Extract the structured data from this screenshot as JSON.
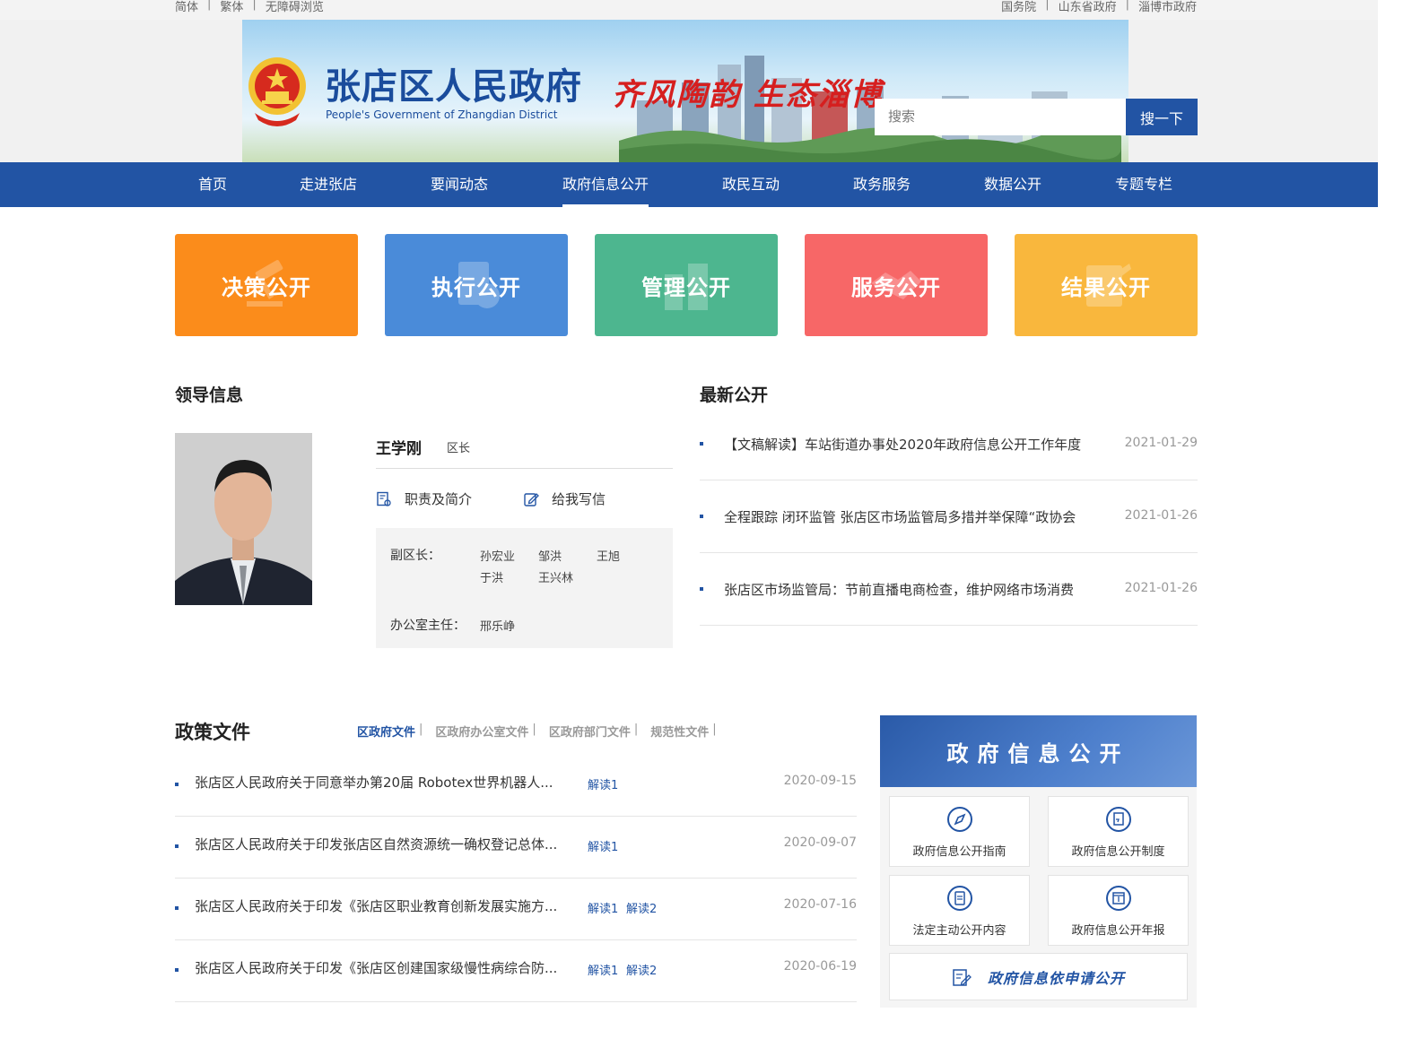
{
  "topbar": {
    "left_links": [
      "简体",
      "繁体",
      "无障碍浏览"
    ],
    "right_links": [
      "国务院",
      "山东省政府",
      "淄博市政府"
    ]
  },
  "header": {
    "title": "张店区人民政府",
    "subtitle": "People's Government of Zhangdian District",
    "slogan": "齐风陶韵  生态淄博",
    "search_placeholder": "搜索",
    "search_button": "搜一下"
  },
  "nav": {
    "items": [
      "首页",
      "走进张店",
      "要闻动态",
      "政府信息公开",
      "政民互动",
      "政务服务",
      "数据公开",
      "专题专栏"
    ],
    "active": "政府信息公开"
  },
  "tiles": [
    {
      "label": "决策公开",
      "color": "#fb8c1b"
    },
    {
      "label": "执行公开",
      "color": "#4a8bd9"
    },
    {
      "label": "管理公开",
      "color": "#4db68f"
    },
    {
      "label": "服务公开",
      "color": "#f76767"
    },
    {
      "label": "结果公开",
      "color": "#f9b73d"
    }
  ],
  "leader": {
    "section_title": "领导信息",
    "name": "王学刚",
    "position": "区长",
    "link_duties": "职责及简介",
    "link_letter": "给我写信",
    "deputy_label": "副区长：",
    "deputies": [
      "孙宏业",
      "邹洪",
      "王旭",
      "于洪",
      "王兴林"
    ],
    "office_label": "办公室主任：",
    "office_director": "邢乐峥"
  },
  "latest": {
    "section_title": "最新公开",
    "items": [
      {
        "title": "【文稿解读】车站街道办事处2020年政府信息公开工作年度",
        "date": "2021-01-29"
      },
      {
        "title": "全程跟踪 闭环监管 张店区市场监管局多措并举保障“政协会",
        "date": "2021-01-26"
      },
      {
        "title": "张店区市场监管局：节前直播电商检查，维护网络市场消费",
        "date": "2021-01-26"
      }
    ]
  },
  "policy": {
    "section_title": "政策文件",
    "tabs": [
      "区政府文件",
      "区政府办公室文件",
      "区政府部门文件",
      "规范性文件"
    ],
    "tab_separator": "|",
    "items": [
      {
        "title": "张店区人民政府关于同意举办第20届 Robotex世界机器人...",
        "reads": [
          "解读1"
        ],
        "date": "2020-09-15"
      },
      {
        "title": "张店区人民政府关于印发张店区自然资源统一确权登记总体...",
        "reads": [
          "解读1"
        ],
        "date": "2020-09-07"
      },
      {
        "title": "张店区人民政府关于印发《张店区职业教育创新发展实施方...",
        "reads": [
          "解读1",
          "解读2"
        ],
        "date": "2020-07-16"
      },
      {
        "title": "张店区人民政府关于印发《张店区创建国家级慢性病综合防...",
        "reads": [
          "解读1",
          "解读2"
        ],
        "date": "2020-06-19"
      }
    ]
  },
  "info_panel": {
    "title": "政府信息公开",
    "cells": [
      {
        "label": "政府信息公开指南",
        "icon": "compass-icon"
      },
      {
        "label": "政府信息公开制度",
        "icon": "document-icon"
      },
      {
        "label": "法定主动公开内容",
        "icon": "clipboard-icon"
      },
      {
        "label": "政府信息公开年报",
        "icon": "calendar-icon"
      }
    ],
    "apply_label": "政府信息依申请公开"
  },
  "colors": {
    "brand": "#2254a4",
    "accent_red": "#d61f1f"
  }
}
